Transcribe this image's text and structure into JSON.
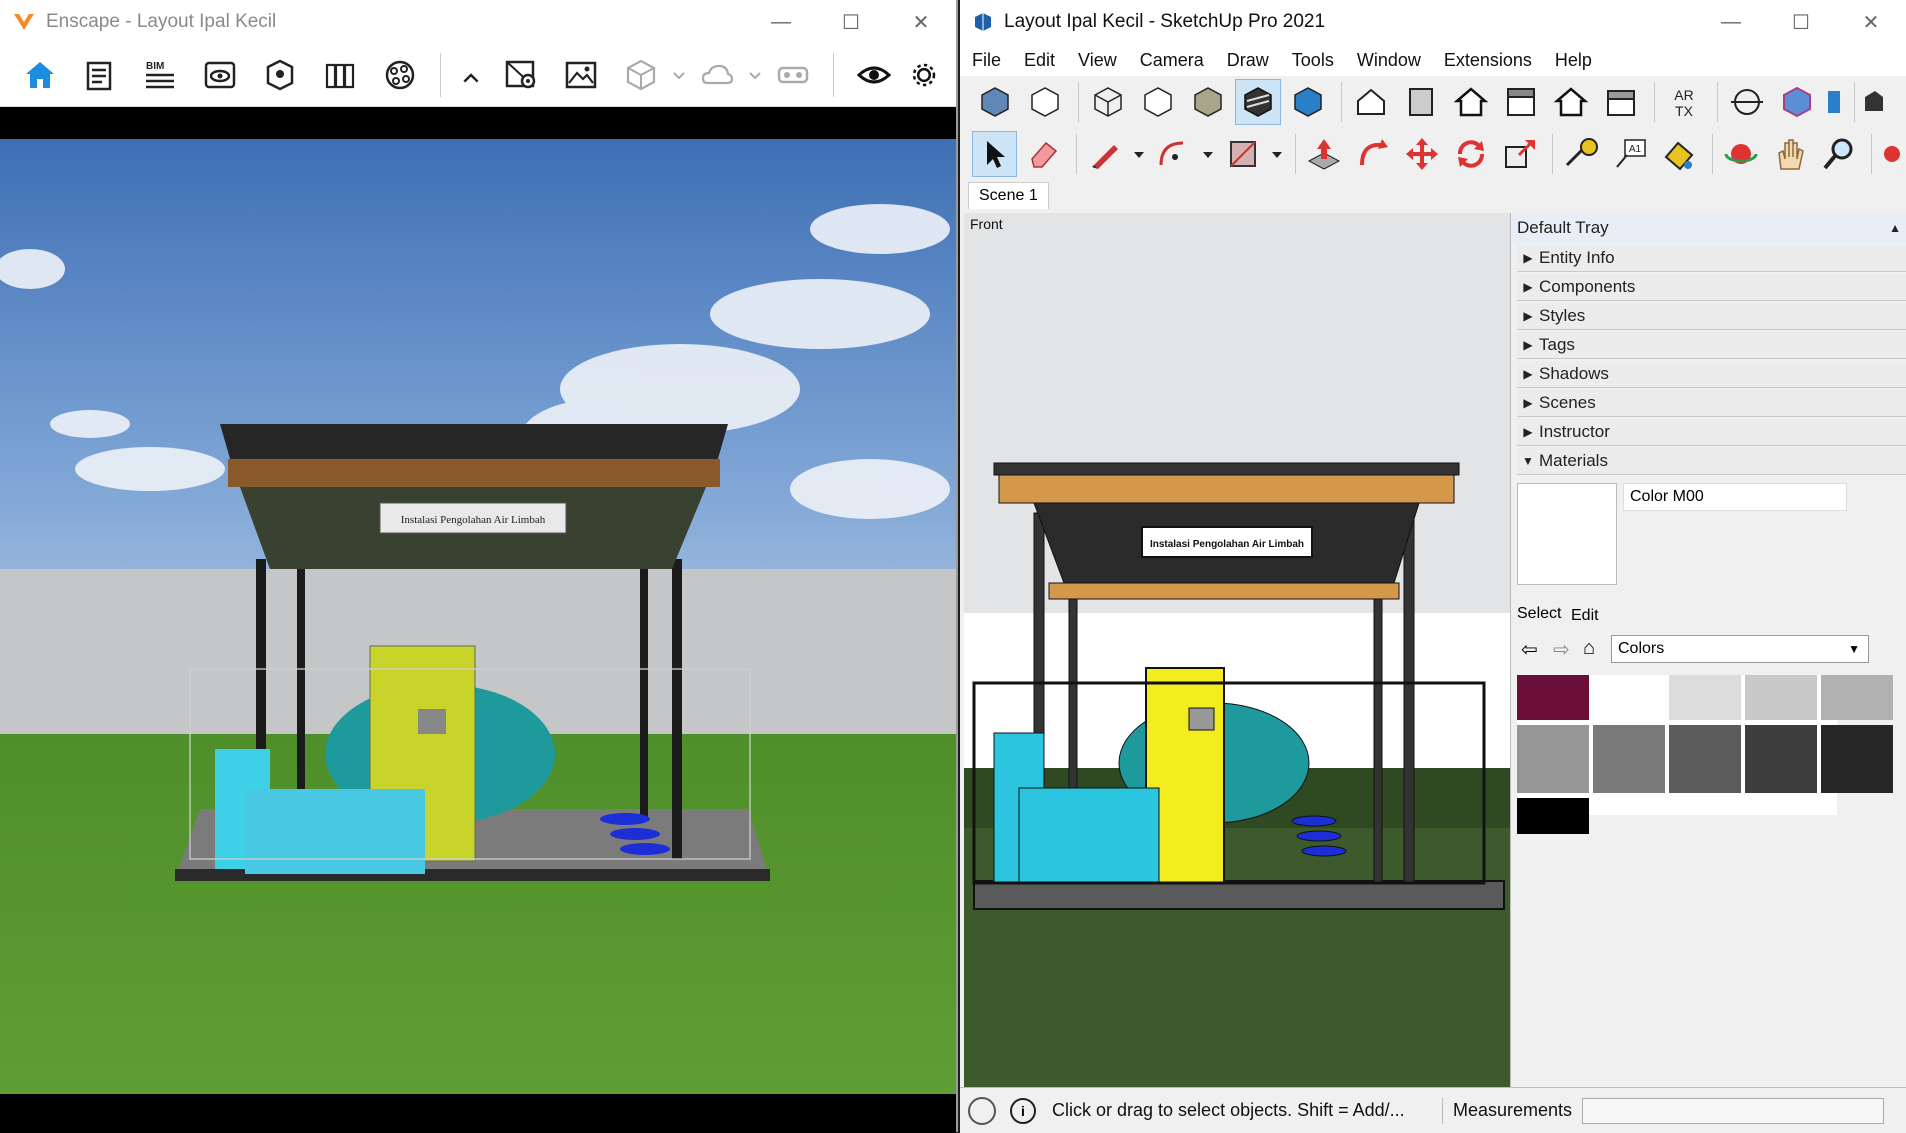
{
  "enscape": {
    "title": "Enscape - Layout Ipal Kecil",
    "toolbar_icons": [
      "home-icon",
      "notes-icon",
      "bim-icon",
      "visual-settings-icon",
      "view-management-icon",
      "asset-library-icon",
      "material-editor-icon",
      "collapse-icon",
      "batch-render-icon",
      "screenshot-icon",
      "export-model-icon",
      "cloud-export-icon",
      "vr-headset-icon",
      "live-update-icon",
      "settings-icon"
    ],
    "bim_label": "BIM",
    "sign_text": "Instalasi Pengolahan Air Limbah"
  },
  "sketchup": {
    "title": "Layout Ipal Kecil - SketchUp Pro 2021",
    "menu": [
      "File",
      "Edit",
      "View",
      "Camera",
      "Draw",
      "Tools",
      "Window",
      "Extensions",
      "Help"
    ],
    "scene_tab": "Scene 1",
    "view_label": "Front",
    "sign_text": "Instalasi Pengolahan Air Limbah",
    "tray": {
      "title": "Default Tray",
      "panels": [
        "Entity Info",
        "Components",
        "Styles",
        "Tags",
        "Shadows",
        "Scenes",
        "Instructor",
        "Materials"
      ],
      "material_name": "Color M00",
      "tab_select": "Select",
      "tab_edit": "Edit",
      "library": "Colors",
      "swatch_colors": [
        "#6b0f3a",
        "#ffffff",
        "#dcdcdc",
        "#c8c8c8",
        "#b0b0b0",
        "#969696",
        "#7a7a7a",
        "#5c5c5c",
        "#3e3e3e",
        "#262626",
        "#000000"
      ]
    },
    "status_text": "Click or drag to select objects. Shift = Add/...",
    "measurements_label": "Measurements"
  }
}
